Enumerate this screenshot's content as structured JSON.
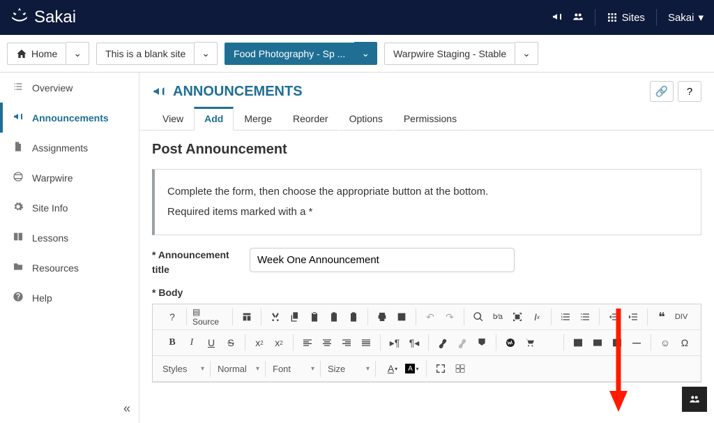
{
  "brand": "Sakai",
  "header": {
    "sites_label": "Sites",
    "user_menu": "Sakai"
  },
  "site_tabs": [
    {
      "label": "Home",
      "icon": "home"
    },
    {
      "label": "This is a blank site"
    },
    {
      "label": "Food Photography - Sp ...",
      "active": true
    },
    {
      "label": "Warpwire Staging - Stable"
    }
  ],
  "sidebar": {
    "items": [
      {
        "label": "Overview",
        "icon": "list"
      },
      {
        "label": "Announcements",
        "icon": "bullhorn",
        "active": true
      },
      {
        "label": "Assignments",
        "icon": "file"
      },
      {
        "label": "Warpwire",
        "icon": "globe"
      },
      {
        "label": "Site Info",
        "icon": "gear"
      },
      {
        "label": "Lessons",
        "icon": "book"
      },
      {
        "label": "Resources",
        "icon": "folder"
      },
      {
        "label": "Help",
        "icon": "question"
      }
    ]
  },
  "tool": {
    "title": "ANNOUNCEMENTS",
    "tabs": [
      "View",
      "Add",
      "Merge",
      "Reorder",
      "Options",
      "Permissions"
    ],
    "active_tab": "Add"
  },
  "page": {
    "heading": "Post Announcement",
    "info_line1": "Complete the form, then choose the appropriate button at the bottom.",
    "info_line2": "Required items marked with a *",
    "title_label": "* Announcement title",
    "title_value": "Week One Announcement",
    "body_label": "* Body"
  },
  "editor_selects": {
    "styles": "Styles",
    "format": "Normal",
    "font": "Font",
    "size": "Size"
  },
  "help_char": "?",
  "link_char": "🔗"
}
